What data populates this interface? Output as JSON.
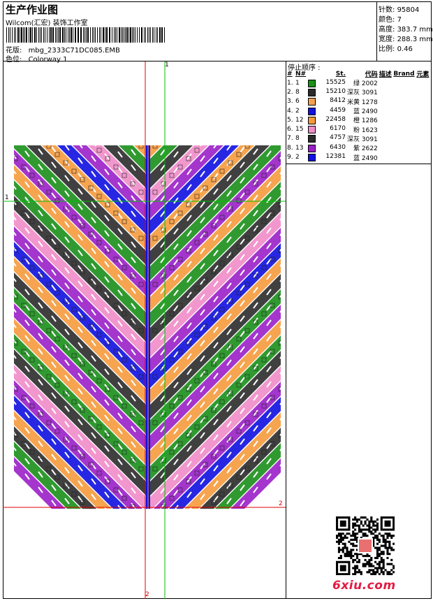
{
  "header": {
    "title": "生产作业图",
    "studio": "Wilcom(汇宏) 装饰工作室",
    "file_label": "花版:",
    "file_name": "mbg_2333C71DC085.EMB",
    "colorway_label": "色位:",
    "colorway": "Colorway 1"
  },
  "stats": [
    {
      "label": "针数:",
      "value": "95804"
    },
    {
      "label": "颜色:",
      "value": "7"
    },
    {
      "label": "高度:",
      "value": "383.7 mm"
    },
    {
      "label": "宽度:",
      "value": "288.3 mm"
    },
    {
      "label": "比例:",
      "value": "0.46"
    }
  ],
  "stop_sequence": {
    "title": "停止顺序 :",
    "columns": [
      "#",
      "N#",
      "St.",
      "代码",
      "描述",
      "Brand",
      "元素"
    ],
    "rows": [
      {
        "idx": "1.",
        "n": "1",
        "color": "#1a8f1a",
        "stitches": "15525",
        "code": "绿 2002"
      },
      {
        "idx": "2.",
        "n": "8",
        "color": "#2b2b2b",
        "stitches": "15210",
        "code": "深灰 3091"
      },
      {
        "idx": "3.",
        "n": "6",
        "color": "#f0a050",
        "stitches": "8412",
        "code": "米黄 1278"
      },
      {
        "idx": "4.",
        "n": "2",
        "color": "#1010e0",
        "stitches": "4459",
        "code": "蓝 2490"
      },
      {
        "idx": "5.",
        "n": "12",
        "color": "#f59a3c",
        "stitches": "22458",
        "code": "橙 1286"
      },
      {
        "idx": "6.",
        "n": "15",
        "color": "#f08cc8",
        "stitches": "6170",
        "code": "粉 1623"
      },
      {
        "idx": "7.",
        "n": "8",
        "color": "#2b2b2b",
        "stitches": "4757",
        "code": "深灰 3091"
      },
      {
        "idx": "8.",
        "n": "13",
        "color": "#9a1fc8",
        "stitches": "6430",
        "code": "紫 2622"
      },
      {
        "idx": "9.",
        "n": "2",
        "color": "#1010e0",
        "stitches": "12381",
        "code": "蓝 2490"
      }
    ]
  },
  "axis_labels": {
    "top": "1",
    "left": "1",
    "right": "2",
    "bottom": "2"
  },
  "watermark": "6xiu.com",
  "palette": {
    "green": "#1a8f1a",
    "dark": "#2b2b2b",
    "orange": "#f59a3c",
    "blue": "#1010e0",
    "pink": "#f08cc8",
    "purple": "#9a1fc8",
    "guide_red": "#e00000",
    "guide_green": "#00c000"
  }
}
